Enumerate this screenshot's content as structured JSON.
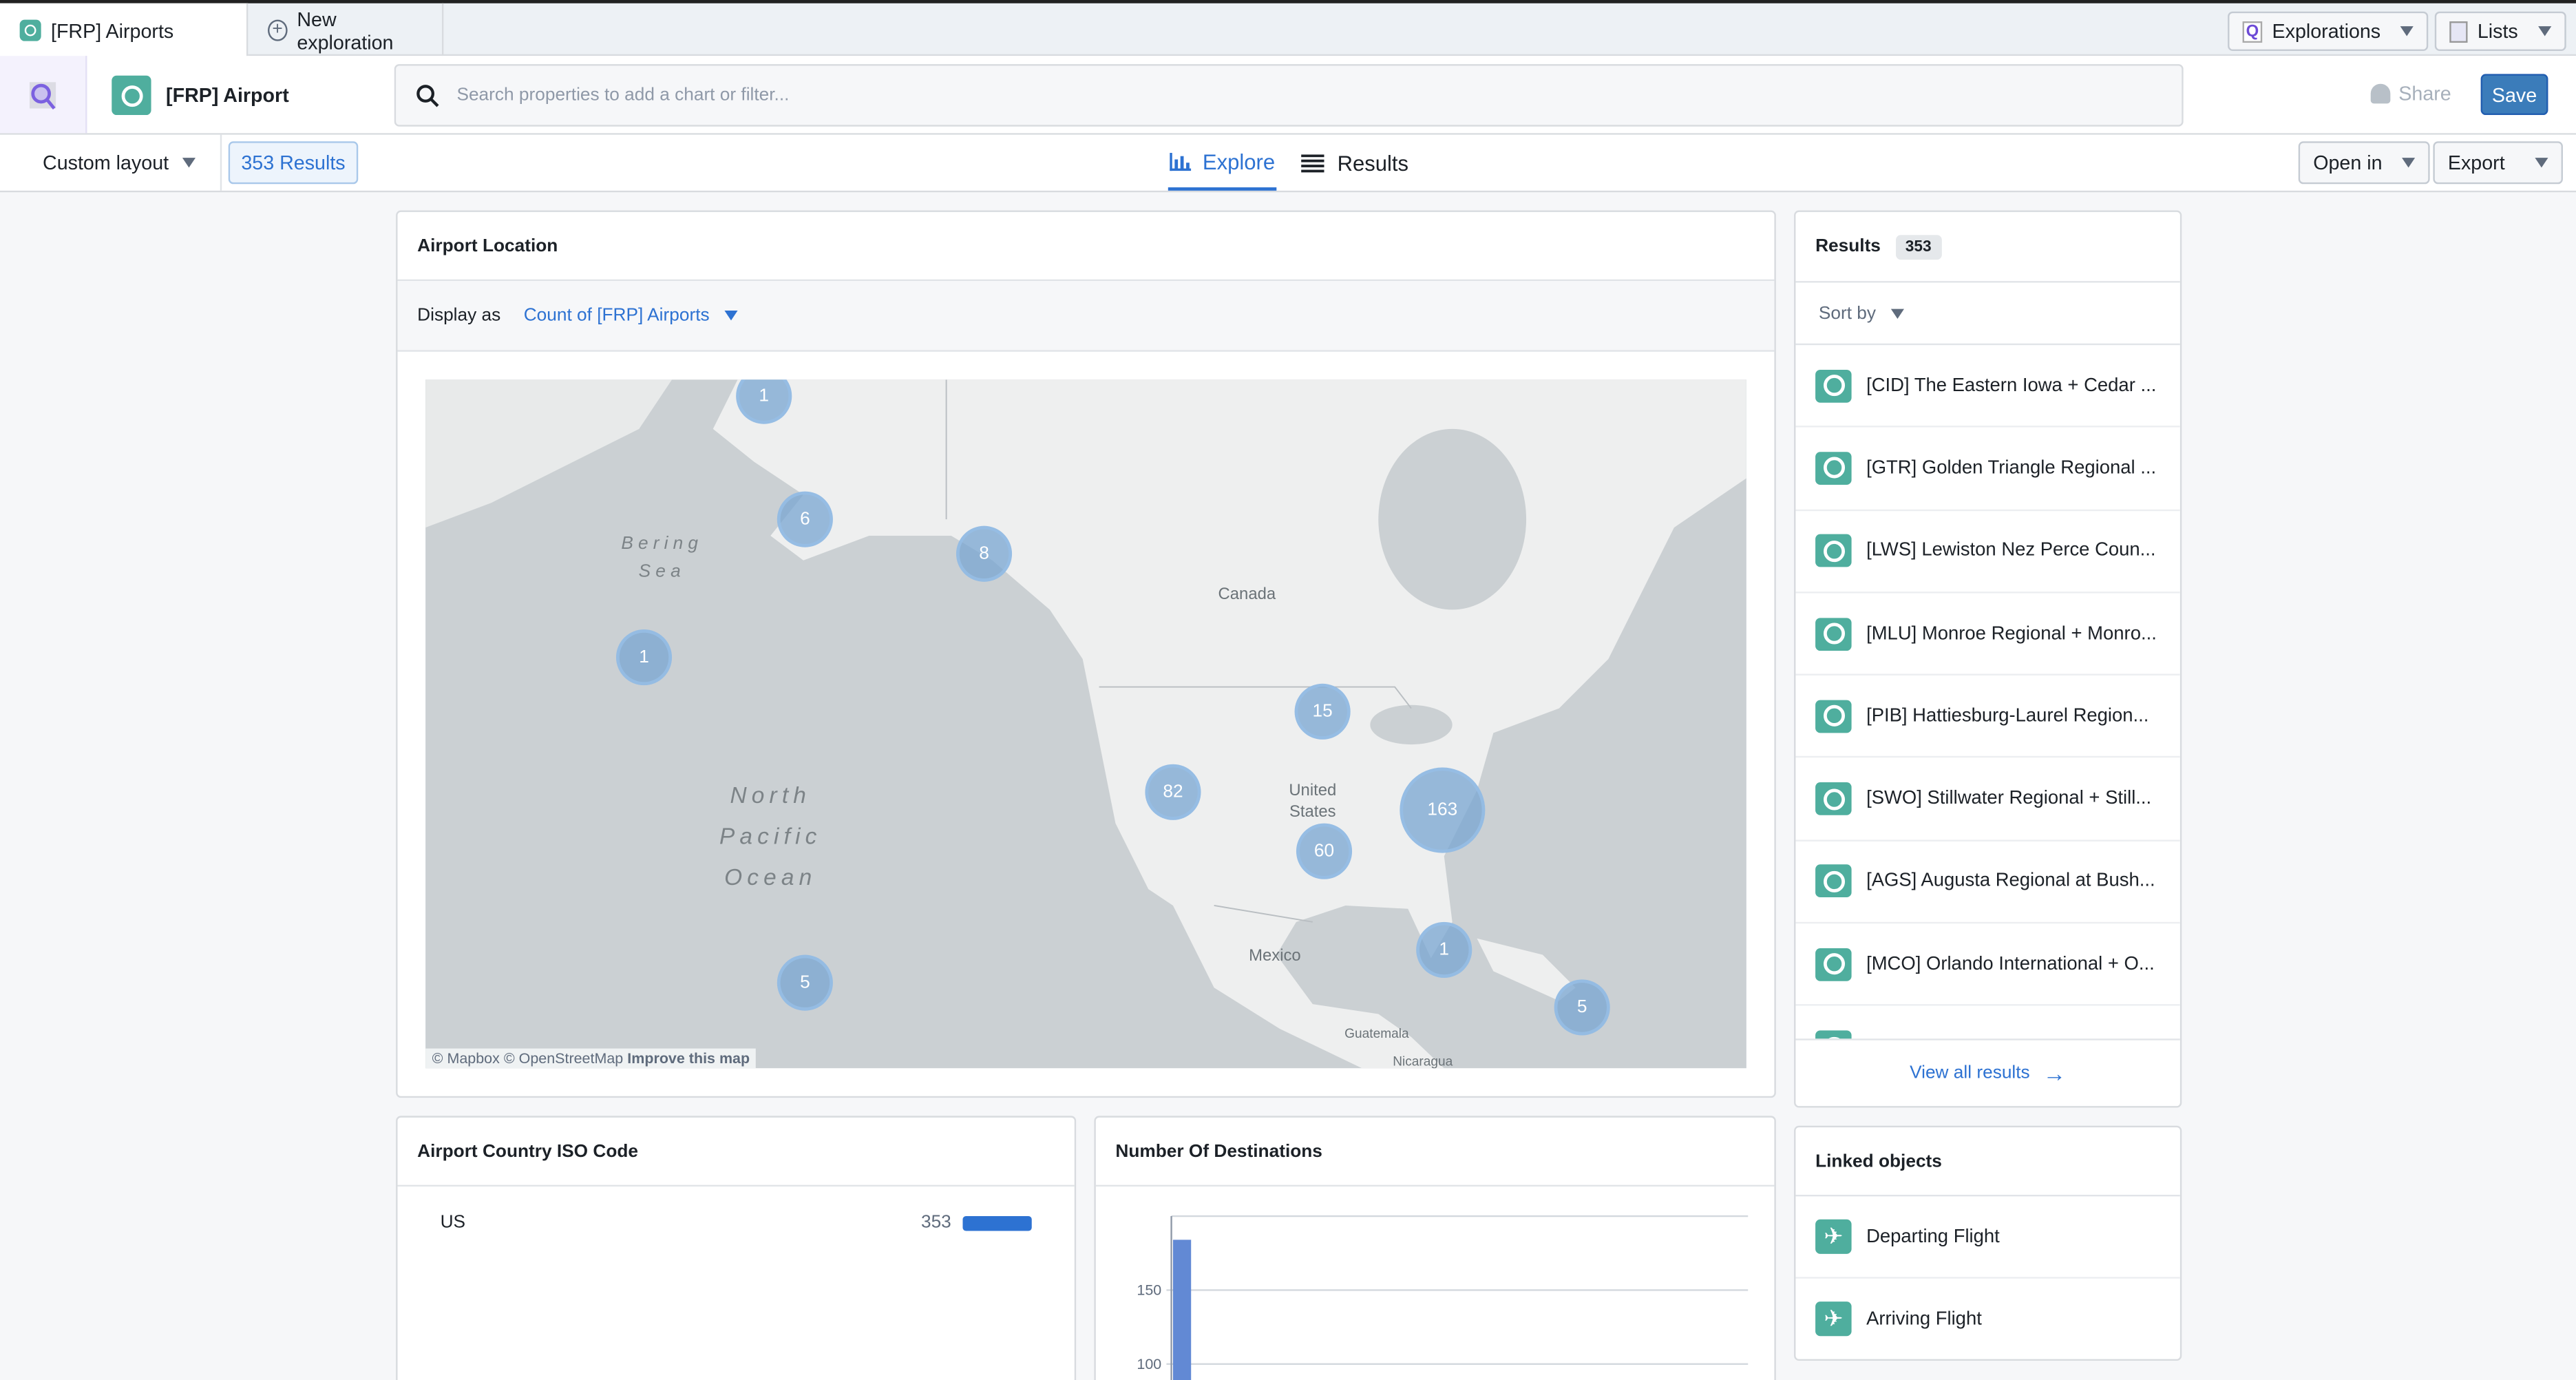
{
  "tabs": {
    "active": "[FRP] Airports",
    "new": "New exploration"
  },
  "top_right": {
    "explorations": "Explorations",
    "lists": "Lists"
  },
  "header": {
    "object_type": "[FRP] Airport",
    "search_placeholder": "Search properties to add a chart or filter...",
    "share": "Share",
    "save": "Save"
  },
  "toolbar": {
    "layout": "Custom layout",
    "results_count": "353 Results",
    "explore": "Explore",
    "results": "Results",
    "open_in": "Open in",
    "export": "Export"
  },
  "map_card": {
    "title": "Airport Location",
    "display_as_label": "Display as",
    "display_as_value": "Count of [FRP] Airports",
    "labels": {
      "bering": "Bering Sea",
      "canada": "Canada",
      "ocean": "North Pacific Ocean",
      "us": "United States",
      "mexico": "Mexico",
      "guatemala": "Guatemala",
      "nicaragua": "Nicaragua"
    },
    "clusters": [
      "1",
      "6",
      "8",
      "1",
      "15",
      "82",
      "163",
      "60",
      "1",
      "5",
      "5"
    ],
    "attribution": "© Mapbox © OpenStreetMap",
    "improve": "Improve this map"
  },
  "country_card": {
    "title": "Airport Country ISO Code",
    "rows": [
      {
        "label": "US",
        "value": "353",
        "fraction": 1.0
      }
    ]
  },
  "dest_card": {
    "title": "Number Of Destinations"
  },
  "chart_data": {
    "type": "bar",
    "title": "Number Of Destinations",
    "y_ticks": [
      "100",
      "150"
    ],
    "ylim": [
      0,
      200
    ],
    "values": [
      184
    ],
    "grid": true,
    "bar_color": "#6289d4"
  },
  "results_panel": {
    "title": "Results",
    "count": "353",
    "sort_by": "Sort by",
    "items": [
      "[CID] The Eastern Iowa + Cedar ...",
      "[GTR] Golden Triangle Regional ...",
      "[LWS] Lewiston Nez Perce Coun...",
      "[MLU] Monroe Regional + Monro...",
      "[PIB] Hattiesburg-Laurel Region...",
      "[SWO] Stillwater Regional + Still...",
      "[AGS] Augusta Regional at Bush...",
      "[MCO] Orlando International + O..."
    ],
    "view_all": "View all results"
  },
  "linked": {
    "title": "Linked objects",
    "items": [
      "Departing Flight",
      "Arriving Flight"
    ]
  },
  "colors": {
    "accent": "#2d72d2",
    "object": "#4fae9e",
    "save": "#3b7cba"
  }
}
